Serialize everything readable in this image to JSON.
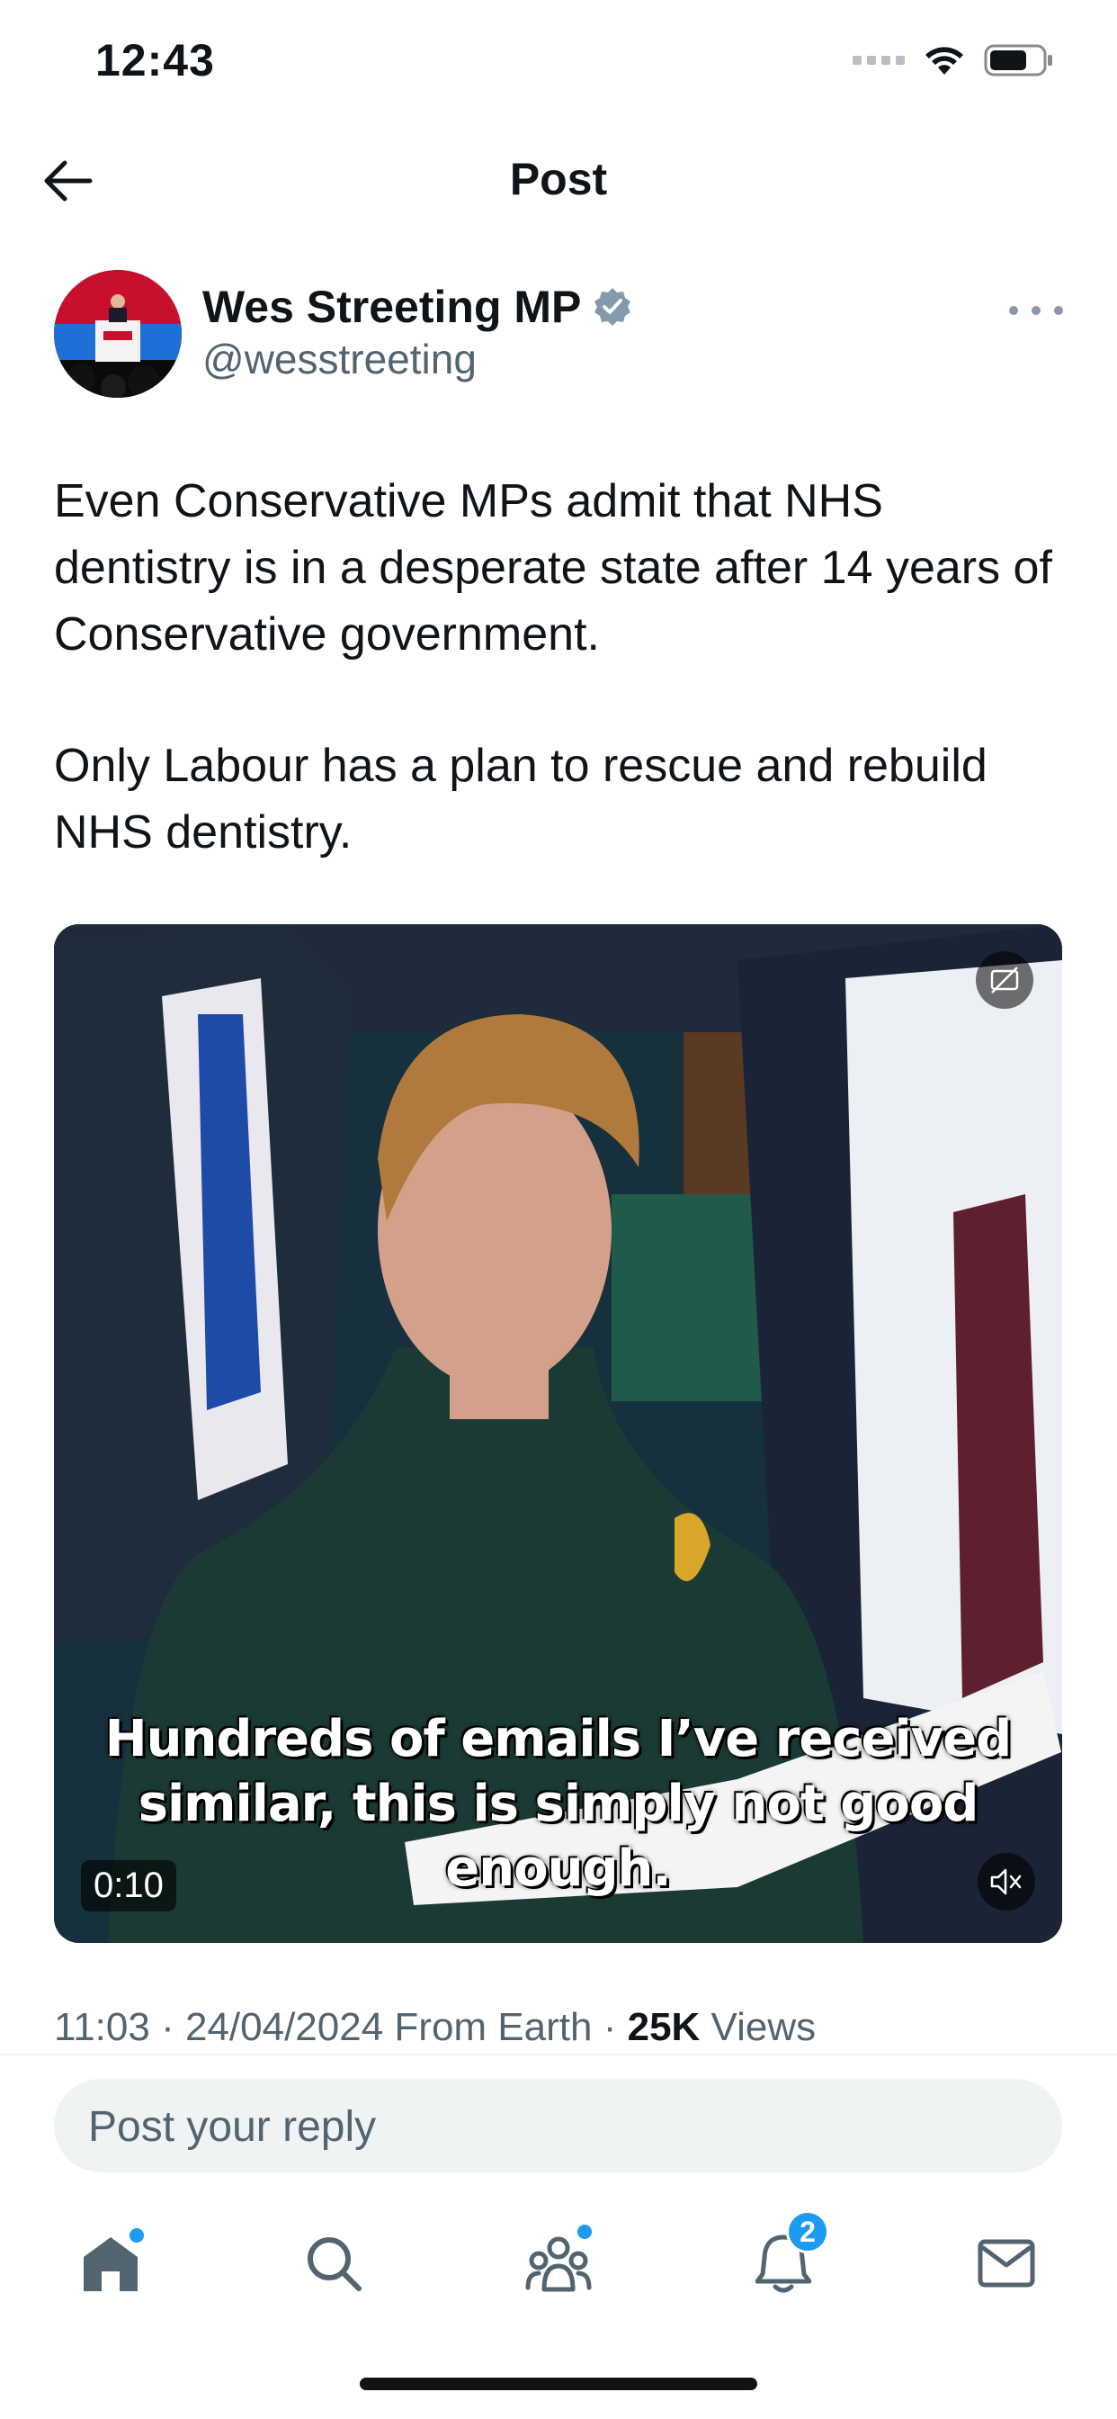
{
  "status_bar": {
    "time": "12:43",
    "icons": [
      "signal-icon",
      "wifi-icon",
      "battery-icon"
    ]
  },
  "header": {
    "title": "Post",
    "back_icon": "arrow-left-icon"
  },
  "author": {
    "name": "Wes Streeting MP",
    "handle": "@wesstreeting",
    "verified": true,
    "verified_color": "#829AAB"
  },
  "post": {
    "paragraphs": [
      "Even Conservative MPs admit that NHS dentistry is in a desperate state after 14 years of Conservative government.",
      "Only Labour has a plan to rescue and rebuild NHS dentistry."
    ]
  },
  "video": {
    "subtitle_line1": "Hundreds of emails I’ve received",
    "subtitle_line2": "similar, this is simply not good enough.",
    "duration": "0:10",
    "muted": true
  },
  "meta": {
    "time": "11:03",
    "separator": "·",
    "date": "24/04/2024",
    "source": "From Earth",
    "views_count": "25K",
    "views_label": "Views"
  },
  "reply": {
    "placeholder": "Post your reply"
  },
  "tab_bar": {
    "tabs": [
      "home-icon",
      "search-icon",
      "communities-icon",
      "notifications-icon",
      "messages-icon"
    ],
    "notifications_badge": "2",
    "accent": "#1D9BF0"
  }
}
